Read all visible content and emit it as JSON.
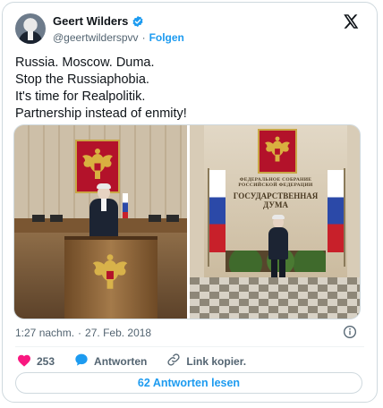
{
  "author": {
    "display_name": "Geert Wilders",
    "handle": "@geertwilderspvv",
    "separator": "·",
    "follow_label": "Folgen",
    "verified_icon": "verified-badge-icon"
  },
  "tweet": {
    "lines": [
      "Russia. Moscow. Duma.",
      "Stop the Russiaphobia.",
      "It's time for Realpolitik.",
      "Partnership instead of enmity!"
    ]
  },
  "media": {
    "right_photo_sign": [
      "ФЕДЕРАЛЬНОЕ СОБРАНИЕ",
      "РОССИЙСКОЙ ФЕДЕРАЦИИ",
      "ГОСУДАРСТВЕННАЯ",
      "ДУМА"
    ]
  },
  "meta": {
    "time": "1:27 nachm.",
    "separator": "·",
    "date": "27. Feb. 2018"
  },
  "actions": {
    "like_count": "253",
    "reply_label": "Antworten",
    "copy_label": "Link kopier."
  },
  "footer": {
    "read_replies_label": "62 Antworten lesen"
  },
  "colors": {
    "accent": "#1d9bf0",
    "like": "#f91880",
    "text_secondary": "#536471"
  }
}
